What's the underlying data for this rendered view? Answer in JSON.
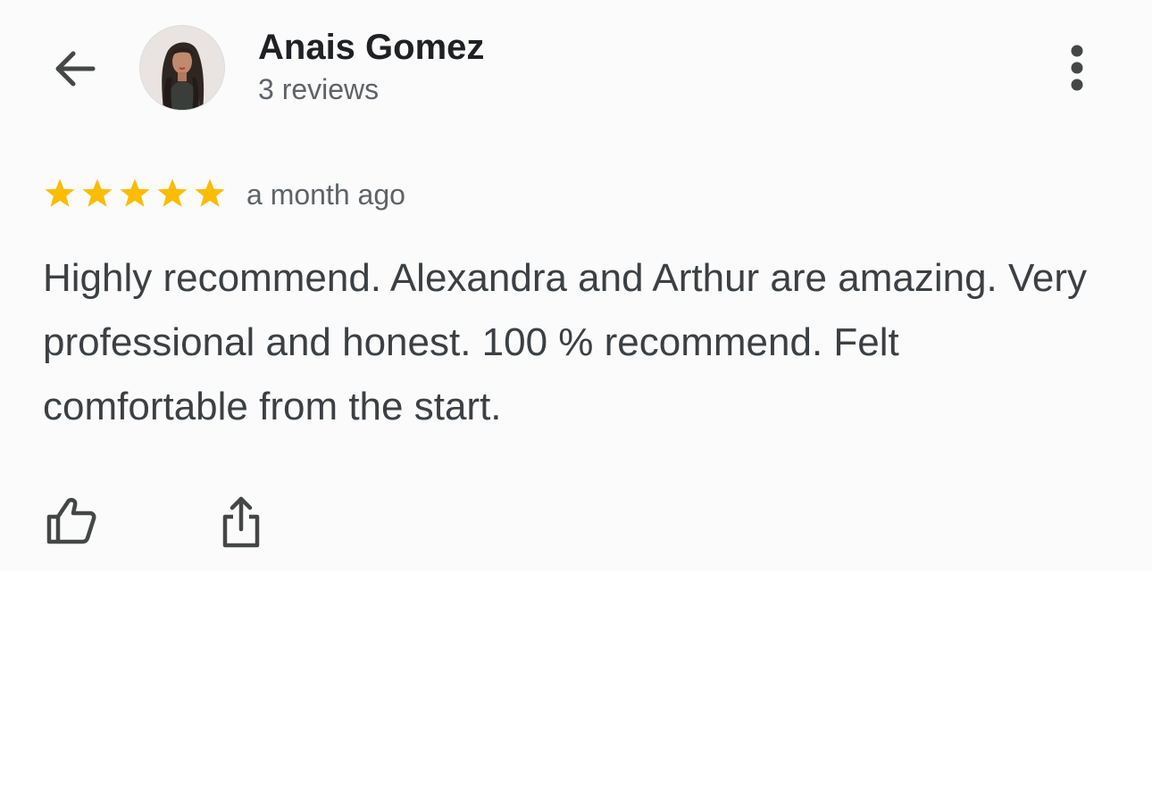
{
  "header": {
    "back_icon": "arrow-back-icon",
    "author_name": "Anais Gomez",
    "review_count": "3 reviews",
    "more_icon": "more-vert-icon"
  },
  "review": {
    "rating": 5,
    "rating_max": 5,
    "time_ago": "a month ago",
    "text": "Highly recommend. Alexandra and Arthur are amazing. Very professional and honest. 100 % recommend. Felt comfortable from the start."
  },
  "actions": {
    "like_icon": "thumb-up-icon",
    "share_icon": "share-icon"
  },
  "colors": {
    "star": "#fbbc04",
    "icon": "#444746",
    "name": "#202124",
    "secondary_text": "#5f6368",
    "body_text": "#3c4043",
    "card_background": "#fbfbfb"
  }
}
